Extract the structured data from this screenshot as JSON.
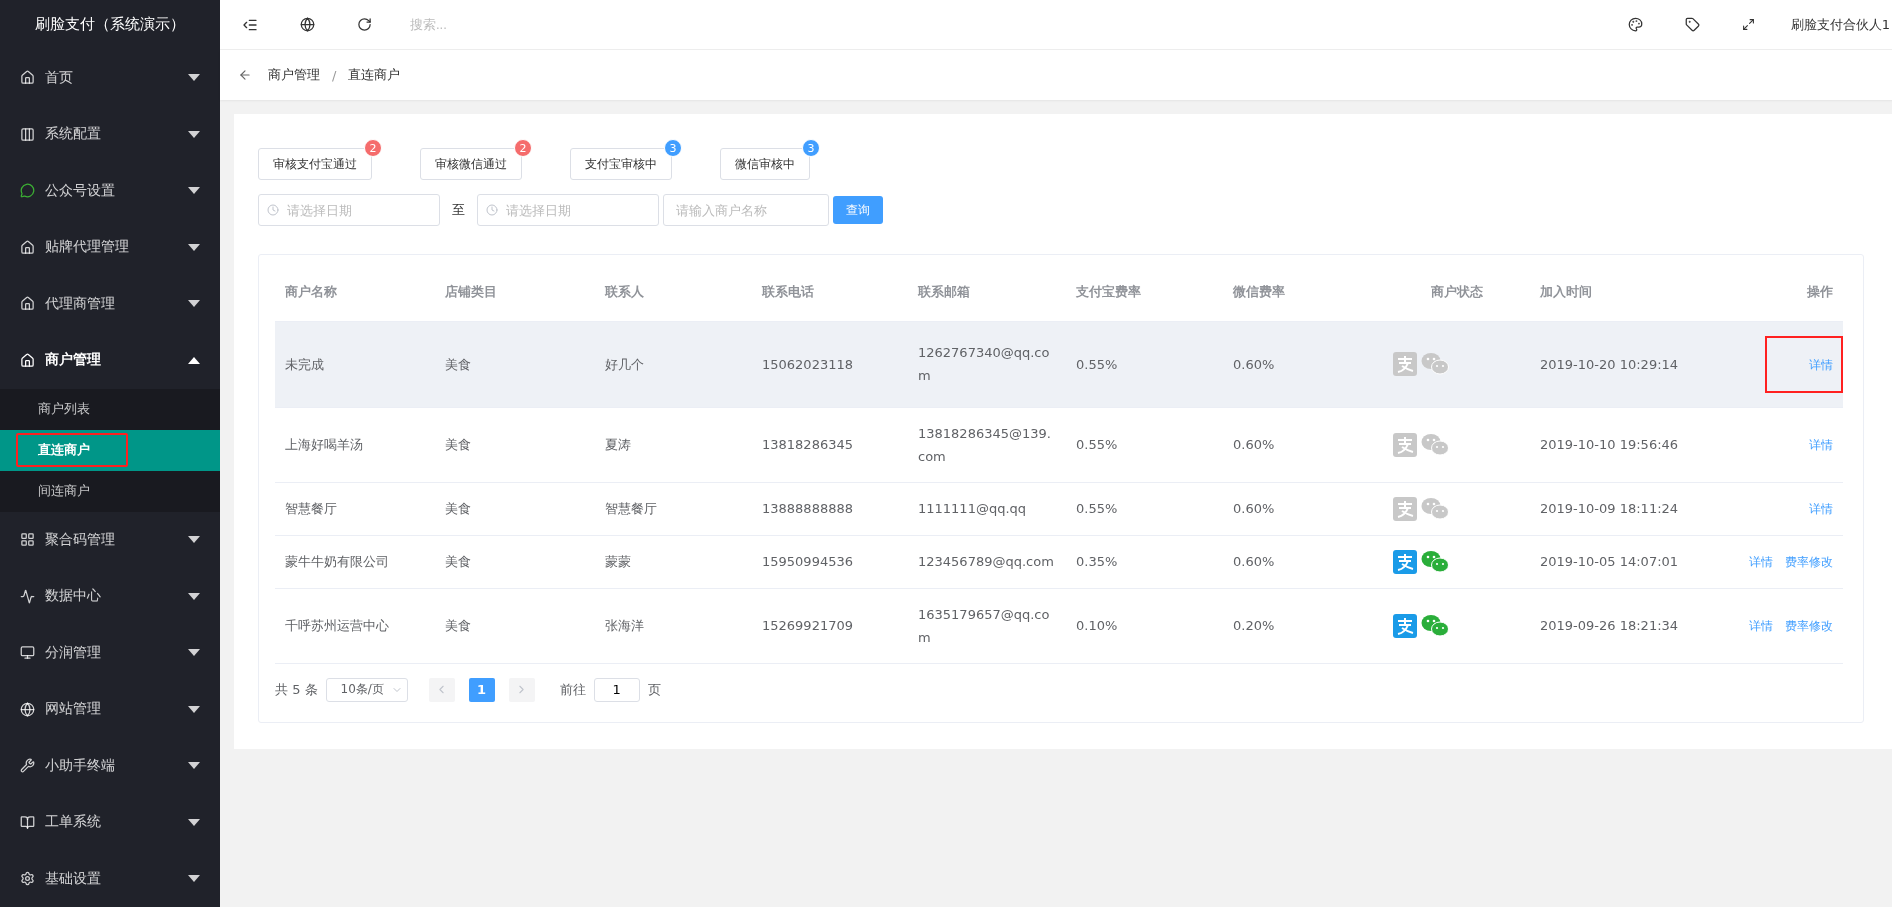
{
  "sidebar": {
    "title": "刷脸支付（系统演示）",
    "items": [
      {
        "kind": "home",
        "label": "首页",
        "expanded": false
      },
      {
        "kind": "config",
        "label": "系统配置",
        "expanded": false
      },
      {
        "kind": "wechat",
        "label": "公众号设置",
        "expanded": false
      },
      {
        "kind": "home",
        "label": "贴牌代理管理",
        "expanded": false
      },
      {
        "kind": "home",
        "label": "代理商管理",
        "expanded": false
      },
      {
        "kind": "home",
        "label": "商户管理",
        "expanded": true,
        "children": [
          {
            "label": "商户列表",
            "selected": false,
            "marked": false
          },
          {
            "label": "直连商户",
            "selected": true,
            "marked": true
          },
          {
            "label": "间连商户",
            "selected": false,
            "marked": false
          }
        ]
      },
      {
        "kind": "grid",
        "label": "聚合码管理",
        "expanded": false
      },
      {
        "kind": "pulse",
        "label": "数据中心",
        "expanded": false
      },
      {
        "kind": "monitor",
        "label": "分润管理",
        "expanded": false
      },
      {
        "kind": "globe",
        "label": "网站管理",
        "expanded": false
      },
      {
        "kind": "tools",
        "label": "小助手终端",
        "expanded": false
      },
      {
        "kind": "book",
        "label": "工单系统",
        "expanded": false
      },
      {
        "kind": "gear",
        "label": "基础设置",
        "expanded": false
      }
    ]
  },
  "topbar": {
    "search": {
      "placeholder": "搜索..."
    },
    "user": "刷脸支付合伙人1"
  },
  "breadcrumb": {
    "items": [
      "商户管理",
      "直连商户"
    ],
    "separator": "/"
  },
  "filter_tabs": [
    {
      "label": "审核支付宝通过",
      "count": "2",
      "color": "#f56c6c"
    },
    {
      "label": "审核微信通过",
      "count": "2",
      "color": "#f56c6c"
    },
    {
      "label": "支付宝审核中",
      "count": "3",
      "color": "#409eff"
    },
    {
      "label": "微信审核中",
      "count": "3",
      "color": "#409eff"
    }
  ],
  "filters": {
    "start_date": {
      "placeholder": "请选择日期"
    },
    "range_separator": "至",
    "end_date": {
      "placeholder": "请选择日期"
    },
    "name": {
      "placeholder": "请输入商户名称"
    },
    "query_button": "查询"
  },
  "table": {
    "columns": [
      "商户名称",
      "店铺类目",
      "联系人",
      "联系电话",
      "联系邮箱",
      "支付宝费率",
      "微信费率",
      "商户状态",
      "加入时间",
      "操作"
    ],
    "rows": [
      {
        "name": "未完成",
        "category": "美食",
        "contact": "好几个",
        "phone": "15062023118",
        "email": "1262767340@qq.com",
        "alipay_rate": "0.55%",
        "wechat_rate": "0.60%",
        "alipay_on": false,
        "wechat_on": false,
        "joined": "2019-10-20 10:29:14",
        "actions": [
          {
            "label": "详情",
            "marked": true
          }
        ],
        "highlighted": true
      },
      {
        "name": "上海好喝羊汤",
        "category": "美食",
        "contact": "夏涛",
        "phone": "13818286345",
        "email": "13818286345@139.com",
        "alipay_rate": "0.55%",
        "wechat_rate": "0.60%",
        "alipay_on": false,
        "wechat_on": false,
        "joined": "2019-10-10 19:56:46",
        "actions": [
          {
            "label": "详情",
            "marked": false
          }
        ],
        "highlighted": false
      },
      {
        "name": "智慧餐厅",
        "category": "美食",
        "contact": "智慧餐厅",
        "phone": "13888888888",
        "email": "1111111@qq.qq",
        "alipay_rate": "0.55%",
        "wechat_rate": "0.60%",
        "alipay_on": false,
        "wechat_on": false,
        "joined": "2019-10-09 18:11:24",
        "actions": [
          {
            "label": "详情",
            "marked": false
          }
        ],
        "highlighted": false
      },
      {
        "name": "蒙牛牛奶有限公司",
        "category": "美食",
        "contact": "蒙蒙",
        "phone": "15950994536",
        "email": "123456789@qq.com",
        "alipay_rate": "0.35%",
        "wechat_rate": "0.60%",
        "alipay_on": true,
        "wechat_on": true,
        "joined": "2019-10-05 14:07:01",
        "actions": [
          {
            "label": "详情",
            "marked": false
          },
          {
            "label": "费率修改",
            "marked": false
          }
        ],
        "highlighted": false
      },
      {
        "name": "千呼苏州运营中心",
        "category": "美食",
        "contact": "张海洋",
        "phone": "15269921709",
        "email": "1635179657@qq.com",
        "alipay_rate": "0.10%",
        "wechat_rate": "0.20%",
        "alipay_on": true,
        "wechat_on": true,
        "joined": "2019-09-26 18:21:34",
        "actions": [
          {
            "label": "详情",
            "marked": false
          },
          {
            "label": "费率修改",
            "marked": false
          }
        ],
        "highlighted": false
      }
    ]
  },
  "pagination": {
    "total": "共 5 条",
    "page_size": "10条/页",
    "pages": [
      {
        "label": "1",
        "selected": true
      }
    ],
    "goto_label": "前往",
    "goto_value": "1",
    "goto_suffix": "页"
  }
}
